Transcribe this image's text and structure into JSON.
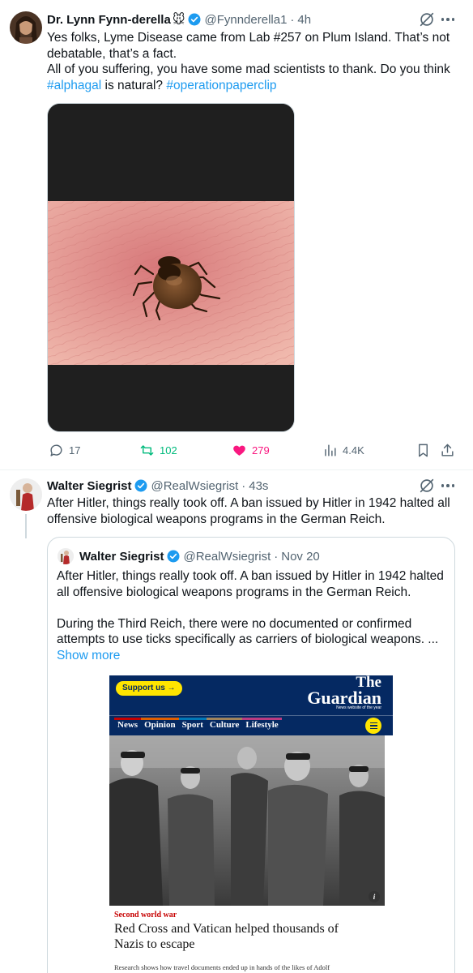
{
  "tweet1": {
    "name": "Dr. Lynn Fynn-derella",
    "name_emoji": "🐭",
    "handle": "@Fynnderella1",
    "time": "4h",
    "text_line1": "Yes folks, Lyme Disease came from Lab #257 on Plum Island. That’s not",
    "text_line2": "debatable, that’s a fact.",
    "text_line3": "All of you suffering, you have some mad scientists to thank. Do you think",
    "hashtag1": "#alphagal",
    "mid_text": " is natural? ",
    "hashtag2": "#operationpaperclip",
    "stats": {
      "replies": "17",
      "reposts": "102",
      "likes": "279",
      "views": "4.4K"
    }
  },
  "tweet2": {
    "name": "Walter Siegrist",
    "handle": "@RealWsiegrist",
    "time": "43s",
    "text_line1": "After Hitler, things really took off. A ban issued by Hitler in 1942 halted all",
    "text_line2": "offensive biological weapons programs in the German Reich."
  },
  "quote": {
    "name": "Walter Siegrist",
    "handle": "@RealWsiegrist",
    "time": "Nov 20",
    "line1": "After Hitler, things really took off. A ban issued by Hitler in 1942 halted",
    "line2": "all offensive biological weapons programs in the German Reich.",
    "line3": "During the Third Reich, there were no documented or confirmed",
    "line4": "attempts to use ticks specifically as carriers of biological weapons. ...",
    "show_more": "Show more"
  },
  "guardian": {
    "support": "Support us →",
    "logo_the": "The",
    "logo_guardian": "Guardian",
    "logo_tagline": "News website of the year",
    "nav": [
      "News",
      "Opinion",
      "Sport",
      "Culture",
      "Lifestyle"
    ],
    "section": "Second world war",
    "headline_line1": "Red Cross and Vatican helped thousands of",
    "headline_line2": "Nazis to escape",
    "standfirst": "Research shows how travel documents ended up in hands of the likes of Adolf",
    "info": "i"
  },
  "colors": {
    "accent": "#1d9bf0",
    "like": "#f91880",
    "repost": "#00ba7c",
    "muted": "#536471",
    "guardian_blue": "#052962",
    "guardian_yellow": "#ffe500",
    "guardian_red": "#c70000"
  }
}
